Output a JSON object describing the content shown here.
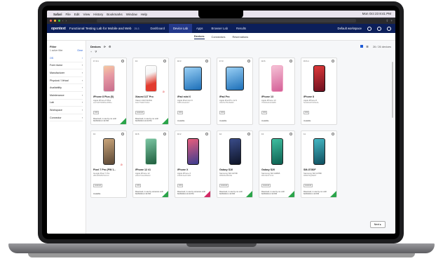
{
  "menubar": {
    "items": [
      "Safari",
      "File",
      "Edit",
      "View",
      "History",
      "Bookmarks",
      "Window",
      "Help"
    ],
    "clock": "Mon Oct 23  8:41 PM"
  },
  "app": {
    "logo": "opentext",
    "title": "Functional Testing Lab for Mobile and Web",
    "version": "25.3",
    "nav": [
      "Dashboard",
      "Device Lab",
      "Apps",
      "Browser Lab",
      "Results"
    ],
    "active_nav": "Device Lab",
    "workspace": "Default workspace"
  },
  "subtabs": [
    "Devices",
    "Connectors",
    "Reservations"
  ],
  "sidebar": {
    "title": "Filter",
    "subtitle": "1 active filter",
    "clear": "Clear",
    "facets": [
      "OS",
      "Form factor",
      "Manufacturer",
      "Physical / Virtual",
      "Availability",
      "Maintenance",
      "Lab",
      "Workspace",
      "Connector"
    ]
  },
  "content": {
    "title": "Devices",
    "count": "26 / 26 devices",
    "next_button": "Next ▸"
  },
  "colors": {
    "header": "#0c1f5a",
    "available": "#2aa44a",
    "reserved": "#d22a66",
    "accent": "#1e5bd6"
  },
  "devices": [
    {
      "os": "17.0.1",
      "name": "iPhone 8 Plus (5)",
      "model": "Apple iPhone 8 Plus",
      "id": "a1c7ab879d9fb1c0f9f1e",
      "status": "Reserved, in use by me until 6/18/2024 2:19 PM",
      "corner": "available",
      "phone": "gold"
    },
    {
      "os": "13",
      "name": "Xiaomi 11T Pro",
      "model": "Xiaomi 2107113SG",
      "id": "9e2c7f1a8cf7d3c2",
      "status": "Reserved, in use by me until 6/18/2024 12:19 PM",
      "corner": "available",
      "phone": "red",
      "blocked": true
    },
    {
      "os": "16.3",
      "name": "iPad mini 6",
      "model": "Apple iPad mini 6",
      "id": "b4ff11c4a1e9c7",
      "status": "Available",
      "corner": "",
      "phone": "tablet"
    },
    {
      "os": "17.0",
      "name": "iPad Pro",
      "model": "Apple iPad Pro 12.9",
      "id": "c82d7e7ff1c8a9d3",
      "status": "Available",
      "corner": "",
      "phone": "tablet"
    },
    {
      "os": "16.6",
      "name": "iPhone 13",
      "model": "Apple iPhone 13",
      "id": "7f3d19e4b2c6a8f0",
      "status": "Available",
      "corner": "",
      "phone": "pink"
    },
    {
      "os": "15.6.1",
      "name": "iPhone 8",
      "model": "Apple iPhone 8",
      "id": "5e1a9c2d7b4f0e3a",
      "status": "Available",
      "corner": "",
      "phone": "black-red"
    },
    {
      "os": "13",
      "name": "Pixel 7 Pro (PW 1...",
      "model": "Google Pixel 7 Pro",
      "id": "2B0106W5MT2GV0",
      "status": "Available",
      "corner": "",
      "phone": "hazel",
      "blocked": true
    },
    {
      "os": "16.6",
      "name": "iPhone 12 #1",
      "model": "Apple iPhone 12",
      "id": "e8d4c7b2a1f09e6d",
      "status": "Reserved, in use by someone until 6/18/2024 2:19 PM",
      "corner": "available",
      "phone": "green"
    },
    {
      "os": "16.2",
      "name": "iPhone X",
      "model": "Apple iPhone X",
      "id": "1f9b8c3e2d7a6f4",
      "status": "Reserved, in use by someone until 6/18/2024 12:19 PM",
      "corner": "reserved",
      "phone": "dark"
    },
    {
      "os": "12",
      "name": "Galaxy S10",
      "model": "Samsung SM-G973F",
      "id": "R58M42ABCDE",
      "status": "Reserved, in use by me until 6/18/2024 1:19 PM",
      "corner": "available",
      "phone": "darkblue"
    },
    {
      "os": "13",
      "name": "Galaxy S20",
      "model": "Samsung SM-G981B",
      "id": "R5CN30XYZ12",
      "status": "Reserved, in use by me until 6/18/2024 2:19 PM",
      "corner": "available",
      "phone": "teal"
    },
    {
      "os": "11",
      "name": "SM-G780F",
      "model": "Samsung SM-G780F",
      "id": "R58R70QWERT",
      "status": "Reserved, in use by me until 6/18/2024 1:19 PM",
      "corner": "available",
      "phone": "teal2"
    }
  ]
}
